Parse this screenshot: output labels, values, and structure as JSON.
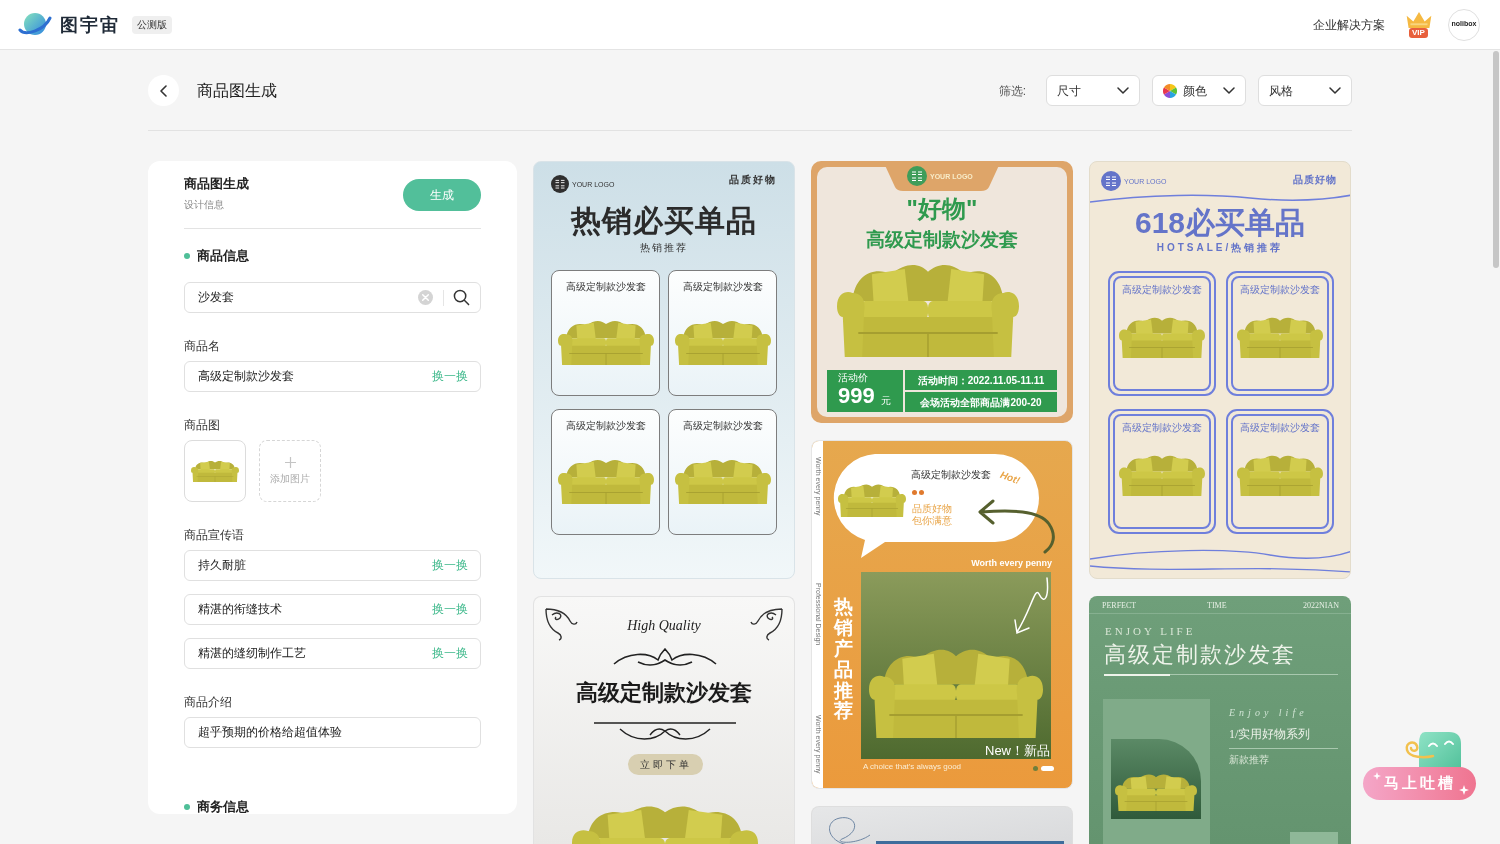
{
  "header": {
    "brand": "图宇宙",
    "badge": "公测版",
    "link": "企业解决方案",
    "vip": "VIP",
    "avatar": "nolibox"
  },
  "toolbar": {
    "title": "商品图生成",
    "filter_label": "筛选:",
    "filters": [
      {
        "label": "尺寸",
        "kind": "plain"
      },
      {
        "label": "颜色",
        "kind": "color"
      },
      {
        "label": "风格",
        "kind": "plain"
      }
    ]
  },
  "form": {
    "title": "商品图生成",
    "subtitle": "设计信息",
    "generate_button": "生成",
    "product_info": {
      "heading": "商品信息",
      "search": {
        "value": "沙发套"
      },
      "name": {
        "label": "商品名",
        "value": "高级定制款沙发套",
        "action": "换一换"
      },
      "images": {
        "label": "商品图",
        "add_label": "添加图片"
      },
      "slogans": {
        "label": "商品宣传语",
        "items": [
          {
            "value": "持久耐脏",
            "action": "换一换"
          },
          {
            "value": "精湛的衔缝技术",
            "action": "换一换"
          },
          {
            "value": "精湛的缝纫制作工艺",
            "action": "换一换"
          }
        ]
      },
      "intro": {
        "label": "商品介绍",
        "value": "超乎预期的价格给超值体验"
      }
    },
    "business_info": {
      "heading": "商务信息"
    }
  },
  "gallery": {
    "columns": [
      {
        "posters": [
          {
            "kind": "grid_blue",
            "logo": "YOUR LOGO",
            "tag": "品质好物",
            "headline": "热销必买单品",
            "subhead": "热销推荐",
            "tiles": [
              "高级定制款沙发套",
              "高级定制款沙发套",
              "高级定制款沙发套",
              "高级定制款沙发套"
            ]
          },
          {
            "kind": "classic",
            "script": "High Quality",
            "headline": "高级定制款沙发套",
            "button": "立即下单"
          }
        ]
      },
      {
        "posters": [
          {
            "kind": "promo_orange",
            "logo": "YOUR LOGO",
            "quote": "\"好物\"",
            "headline": "高级定制款沙发套",
            "price_label": "活动价",
            "price": "999",
            "unit": "元",
            "time": "活动时间：2022.11.05-11.11",
            "offer": "会场活动全部商品满200-20"
          },
          {
            "kind": "hot_orange",
            "side_texts": [
              "Worth every penny",
              "Professional Design",
              "Worth every penny"
            ],
            "bubble_title": "高级定制款沙发套",
            "hot": "Hot!",
            "bubble_lines": [
              "品质好物",
              "包你满意"
            ],
            "tagline": "Worth every penny",
            "vertical_title": "热销产品推荐",
            "new_label": "New！新品",
            "footer": "A choice that's always good"
          },
          {
            "kind": "marble"
          }
        ]
      },
      {
        "posters": [
          {
            "kind": "grid_beige",
            "logo": "YOUR LOGO",
            "tag": "品质好物",
            "headline": "618必买单品",
            "subhead": "HOTSALE/热销推荐",
            "tiles": [
              "高级定制款沙发套",
              "高级定制款沙发套",
              "高级定制款沙发套",
              "高级定制款沙发套"
            ]
          },
          {
            "kind": "green_life",
            "top": [
              "PERFECT",
              "TIME",
              "2022NIAN"
            ],
            "eyebrow": "ENJOY LIFE",
            "headline": "高级定制款沙发套",
            "script": "Enjoy life",
            "series": "1/实用好物系列",
            "note": "新款推荐"
          }
        ]
      }
    ]
  },
  "feedback": {
    "label": "马上吐槽"
  }
}
